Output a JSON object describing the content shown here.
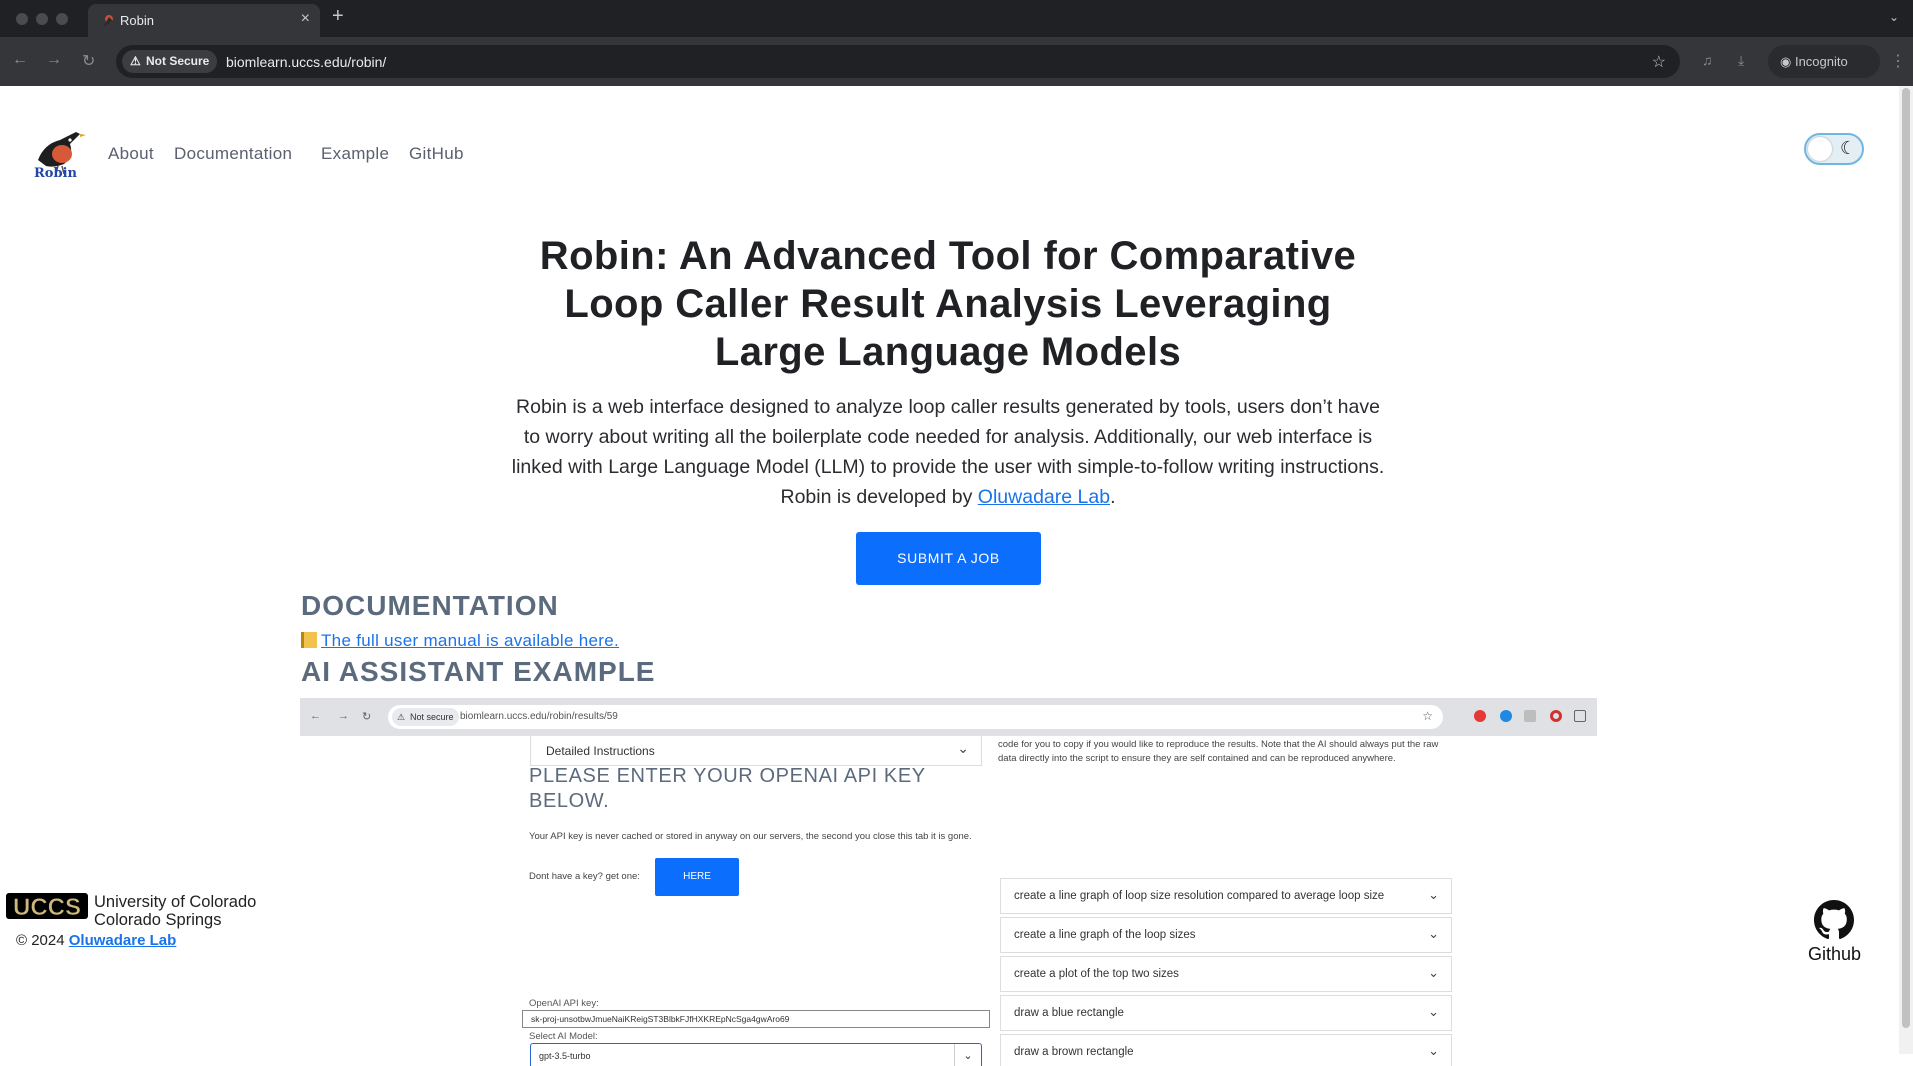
{
  "browser": {
    "tab_title": "Robin",
    "tab_close": "×",
    "new_tab": "+",
    "tab_menu": "⌄",
    "security_label": "Not Secure",
    "url": "biomlearn.uccs.edu/robin/",
    "profile_label": "Incognito"
  },
  "site": {
    "logo_text": "Robin",
    "nav": [
      "About",
      "Documentation",
      "Example",
      "GitHub"
    ],
    "hero_title": "Robin: An Advanced Tool for Comparative Loop Caller Result Analysis Leveraging Large Language Models",
    "hero_desc": "Robin is a web interface designed to analyze loop caller results generated by tools, users don’t have to worry about writing all the boilerplate code needed for analysis. Additionally, our web interface is linked with Large Language Model (LLM) to provide the user with simple-to-follow writing instructions. Robin is developed by ",
    "hero_link": "Oluwadare Lab",
    "hero_period": ".",
    "submit_label": "SUBMIT A JOB",
    "doc_heading": "DOCUMENTATION",
    "manual_link": "The full user manual is available here.",
    "ai_heading": "AI ASSISTANT EXAMPLE"
  },
  "embed": {
    "security_label": "Not secure",
    "url": "biomlearn.uccs.edu/robin/results/59",
    "select_label": "Detailed Instructions",
    "heading": "PLEASE ENTER YOUR OPENAI API KEY BELOW.",
    "privacy_note": "Your API key is never cached or stored in anyway on our servers, the second you close this tab it is gone.",
    "get_key_text": "Dont have a key? get one:",
    "here_label": "HERE",
    "key_label": "OpenAI API key:",
    "key_value": "sk-proj-unsotbwJmueNaiKReigST3BlbkFJfHXKREpNcSga4gwAro69",
    "model_label": "Select AI Model:",
    "model_value": "gpt-3.5-turbo",
    "right_note": "code for you to copy if you would like to reproduce the results. Note that the AI should always put the raw data directly into the script to ensure they are self contained and can be reproduced anywhere.",
    "accordions": [
      "create a line graph of loop size resolution compared to average loop size",
      "create a line graph of the loop sizes",
      "create a plot of the top two sizes",
      "draw a blue rectangle",
      "draw a brown rectangle"
    ]
  },
  "footer": {
    "uccs_logo_text": "UCCS",
    "university_line1": "University of Colorado",
    "university_line2": "Colorado Springs",
    "copyright": "© 2024 ",
    "copyright_link": "Oluwadare Lab",
    "github_label": "Github"
  },
  "colors": {
    "accent": "#0b6efd",
    "link": "#1a73e8",
    "heading": "#5b6b7d"
  }
}
